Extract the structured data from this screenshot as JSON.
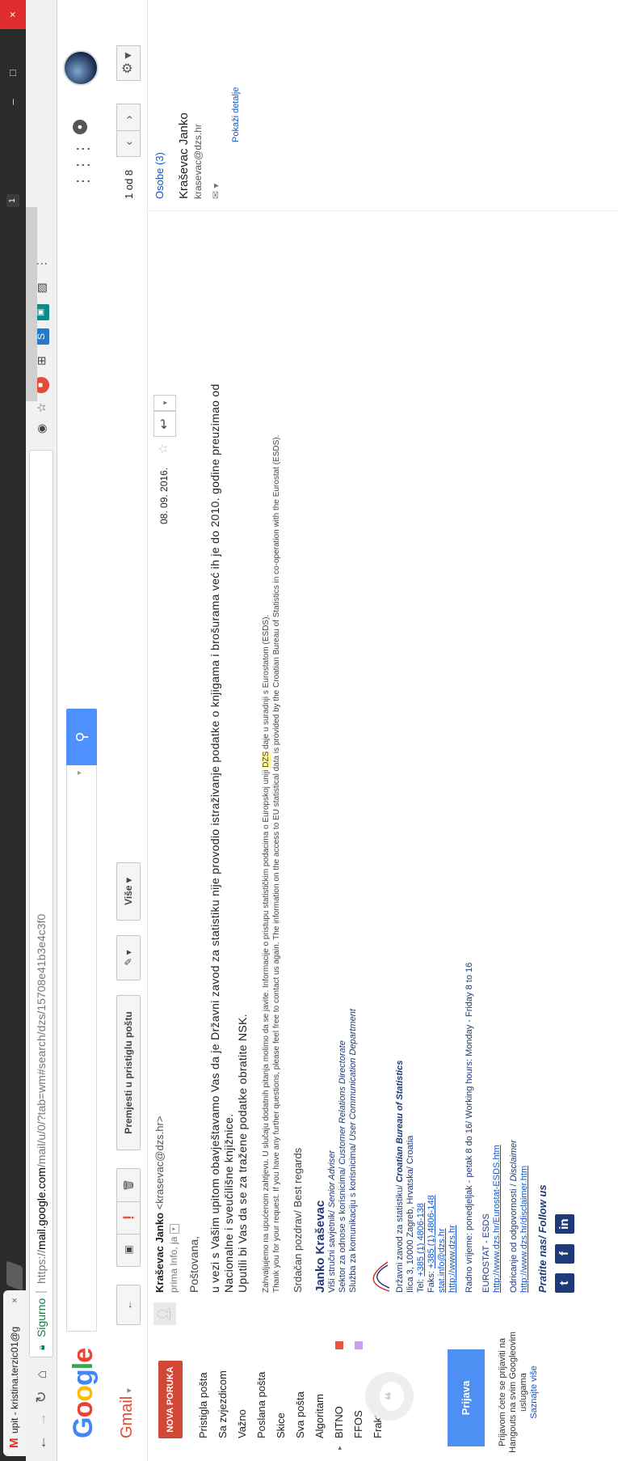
{
  "browser": {
    "tab_title": "upit - kristina.terzic01@g",
    "tab_favicon": "M",
    "tab_close": "×",
    "secure_label": "Sigurno",
    "url_scheme": "https://",
    "url_host": "mail.google.com",
    "url_path": "/mail/u/0/?tab=wm#search/dzs/15708e41b3e4c3f0",
    "extension_badge": "1",
    "window_close": "×",
    "window_min": "–",
    "window_max": "□"
  },
  "header": {
    "logo_letters": [
      "G",
      "o",
      "o",
      "g",
      "l",
      "e"
    ],
    "search_value": "",
    "search_dropdown": "▾",
    "search_button_icon": "⚲",
    "apps_icon": "⋮⋮⋮",
    "notifications_icon": "●"
  },
  "actions": {
    "gmail_label": "Gmail",
    "back": "←",
    "archive": "▣",
    "spam": "❗",
    "delete": "🗑",
    "move_to_inbox": "Premjesti u pristiglu poštu",
    "labels": "✎ ▾",
    "more": "Više ▾",
    "counter": "1 od 8",
    "prev": "‹",
    "next": "›",
    "settings": "⚙ ▾"
  },
  "nav": {
    "compose": "NOVA PORUKA",
    "items": [
      {
        "label": "Pristigla pošta"
      },
      {
        "label": "Sa zvjezdicom"
      },
      {
        "label": "Važno"
      },
      {
        "label": "Poslana pošta"
      },
      {
        "label": "Skice"
      },
      {
        "label": "Sva pošta"
      },
      {
        "label": "Algoritam"
      },
      {
        "label": "BITNO",
        "color": "#e8553e"
      },
      {
        "label": "FFOS",
        "color": "#c7a0ef"
      },
      {
        "label": "Fraktura"
      }
    ],
    "hangouts_button": "Prijava",
    "hangouts_note": "Prijavom ćete se prijaviti na Hangouts na svim Googleovim uslugama",
    "hangouts_more": "Saznajte više"
  },
  "message": {
    "sender_name": "Kraševac Janko",
    "sender_email": "<krasevac@dzs.hr>",
    "recipients": "prima Info, ja",
    "date": "08. 09. 2016.",
    "greeting": "Poštovana,",
    "body_1": "u vezi s Vašim upitom obavještavamo Vas da je Državni zavod za statistiku nije provodio istraživanje podatke o knjigama i brošurama već ih je do 2010. godine preuzimao od Nacionalne i sveučilišne knjižnice.",
    "body_2": "Uputili bi Vas da se za tražene podatke obratite NSK.",
    "fine_1a": "Zahvaljujemo na upućenom zahtjevu. U slučaju dodatnih pitanja molimo da se javite. Informacije o pristupu statističkim podacima o Europskoj uniji",
    "fine_1hl": "DZS",
    "fine_1b": "daje u suradnji s Eurostatom (ESDS).",
    "fine_2": "Thank you for your request. If you have any further questions, please feel free to contact us again. The information on the access to EU statistical data is provided by the Croatian Bureau of Statistics in co-operation with the Eurostat (ESDS).",
    "regards": "Srdačan pozdrav/ Best regards",
    "sig_name": "Janko Kraševac",
    "sig_title": "Viši stručni savjetnik/",
    "sig_title_en": "Senior Adviser",
    "sig_sector": "Sektor za odnose s korisnicima/",
    "sig_sector_en": "Customer Relations Directorate",
    "sig_service": "Služba za komunikaciju s korisnicima/",
    "sig_service_en": "User Communication Department",
    "org": "Državni zavod za statistiku/",
    "org_en": "Croatian Bureau of Statistics",
    "address": "Ilica 3, 10000 Zagreb, Hrvatska/ Croatia",
    "tel_label": "Tel:",
    "tel": "+385 (1) 4806-138",
    "fax_label": "Faks:",
    "fax": "+385 (1) 4806-148",
    "email": "stat.info@dzs.hr",
    "web": "http://www.dzs.hr",
    "hours": "Radno vrijeme: ponedjeljak - petak 8 do 16/ Working hours: Monday - Friday 8 to 16",
    "eurostat_label": "EUROSTAT - ESDS",
    "eurostat_link": "http://www.dzs.hr/Eurostat-ESDS.htm",
    "disclaimer_label": "Odricanje od odgovornosti /",
    "disclaimer_label_en": "Disclaimer",
    "disclaimer_link": "http://www.dzs.hr/disclaimer.htm",
    "follow": "Pratite nas/ Follow us",
    "social": [
      "t",
      "f",
      "in"
    ]
  },
  "people": {
    "title": "Osobe (3)",
    "name": "Kraševac Janko",
    "email": "krasevac@dzs.hr",
    "actions": "✉ ▾",
    "details": "Pokaži detalje"
  },
  "colors": {
    "compose": "#d14836",
    "search_button": "#4d90fe",
    "signin": "#4d8ff2",
    "signature": "#1f3a78",
    "link": "#1155cc"
  }
}
